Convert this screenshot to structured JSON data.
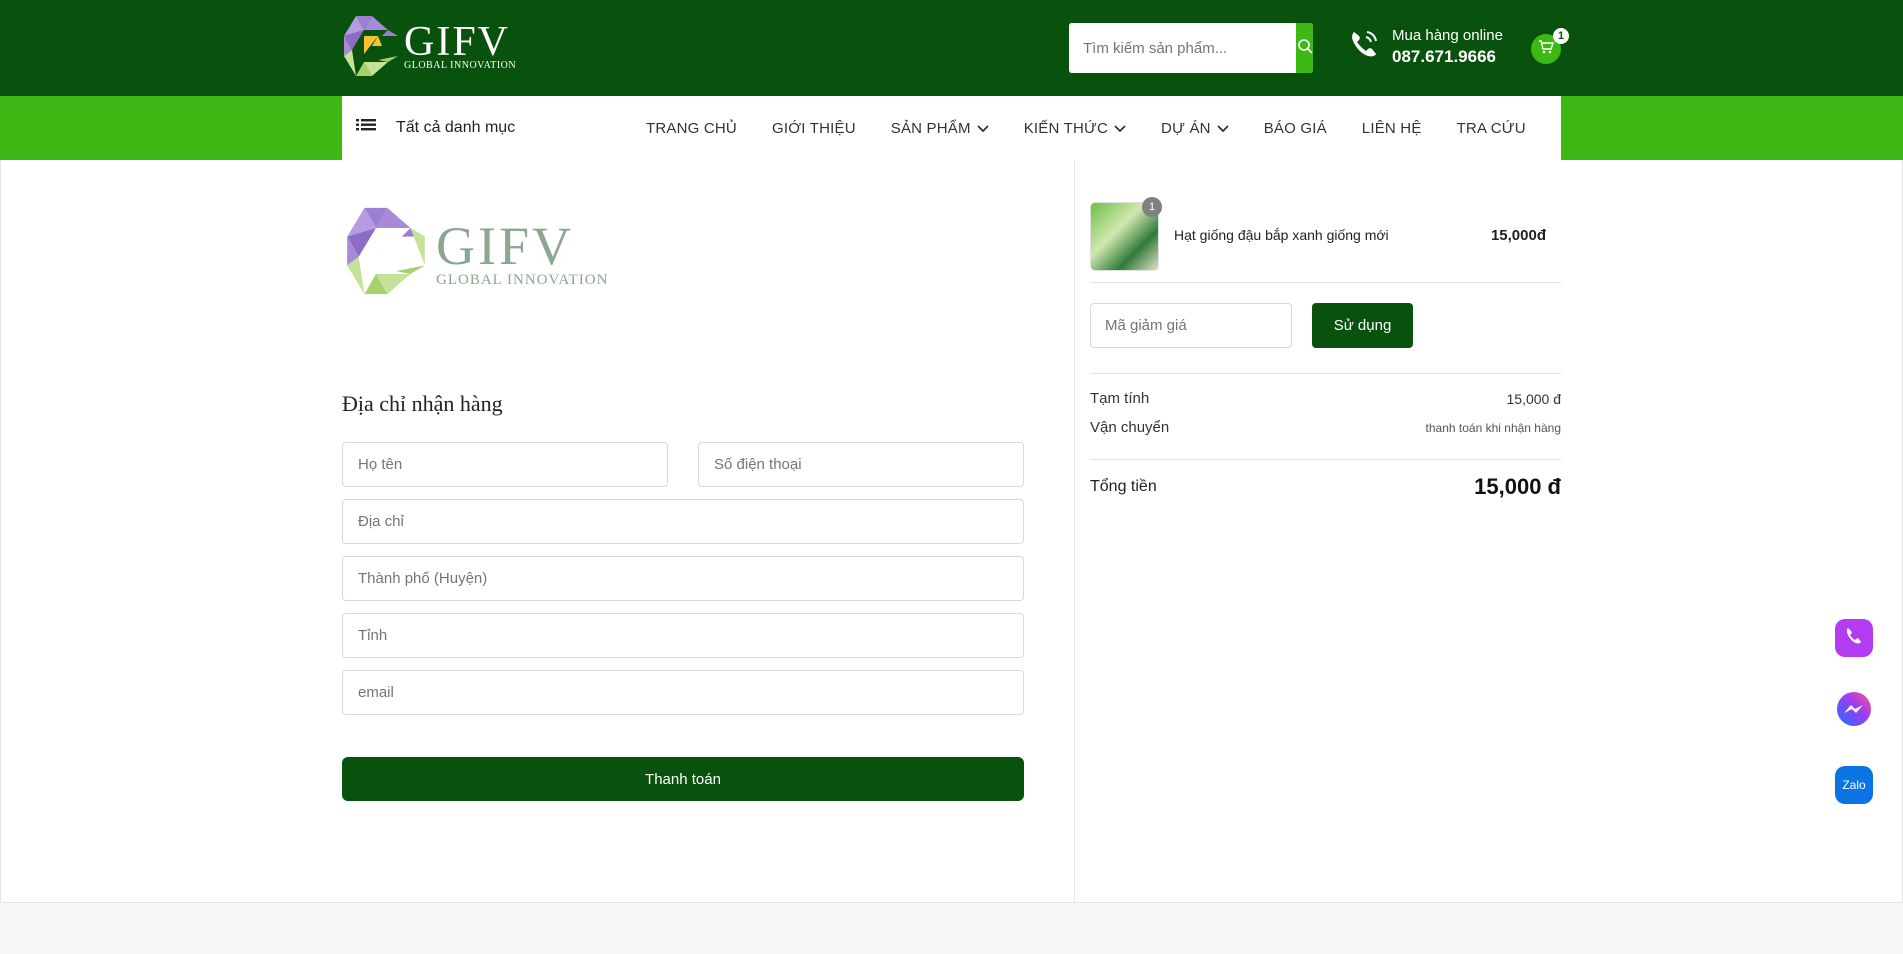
{
  "header": {
    "logo": {
      "wordmark": "GIFV",
      "tagline": "GLOBAL INNOVATION"
    },
    "search": {
      "placeholder": "Tìm kiếm sản phẩm...",
      "icon": "search-icon"
    },
    "hotline": {
      "label": "Mua hàng online",
      "number": "087.671.9666",
      "icon": "phone-icon"
    },
    "cart": {
      "count": "1",
      "icon": "cart-icon"
    },
    "colors": {
      "primary": "#09520e",
      "accent": "#3db814"
    }
  },
  "nav": {
    "all_categories": "Tất cả danh mục",
    "items": [
      {
        "label": "TRANG CHỦ",
        "dropdown": false
      },
      {
        "label": "GIỚI THIỆU",
        "dropdown": false
      },
      {
        "label": "SẢN PHẨM",
        "dropdown": true
      },
      {
        "label": "KIẾN THỨC",
        "dropdown": true
      },
      {
        "label": "DỰ ÁN",
        "dropdown": true
      },
      {
        "label": "BÁO GIÁ",
        "dropdown": false
      },
      {
        "label": "LIÊN HỆ",
        "dropdown": false
      },
      {
        "label": "TRA CỨU",
        "dropdown": false
      }
    ]
  },
  "checkout": {
    "logo": {
      "wordmark": "GIFV",
      "tagline": "GLOBAL INNOVATION"
    },
    "form_title": "Địa chỉ nhận hàng",
    "fields": {
      "name": {
        "placeholder": "Họ tên",
        "value": ""
      },
      "phone": {
        "placeholder": "Số điện thoại",
        "value": ""
      },
      "address": {
        "placeholder": "Địa chỉ",
        "value": ""
      },
      "city": {
        "placeholder": "Thành phố (Huyện)",
        "value": ""
      },
      "province": {
        "placeholder": "Tỉnh",
        "value": ""
      },
      "email": {
        "placeholder": "email",
        "value": ""
      }
    },
    "submit_label": "Thanh toán"
  },
  "order": {
    "product": {
      "name": "Hạt giống đậu bắp xanh giống mới",
      "price": "15,000đ",
      "qty": "1"
    },
    "coupon": {
      "placeholder": "Mã giảm giá",
      "button": "Sử dụng"
    },
    "subtotal": {
      "label": "Tạm tính",
      "value": "15,000 đ"
    },
    "shipping": {
      "label": "Vận chuyển",
      "value": "thanh toán khi nhận hàng"
    },
    "total": {
      "label": "Tổng tiền",
      "value": "15,000 đ"
    }
  },
  "floating": {
    "phone_icon": "phone-icon",
    "messenger_icon": "messenger-icon",
    "zalo_label": "Zalo"
  }
}
